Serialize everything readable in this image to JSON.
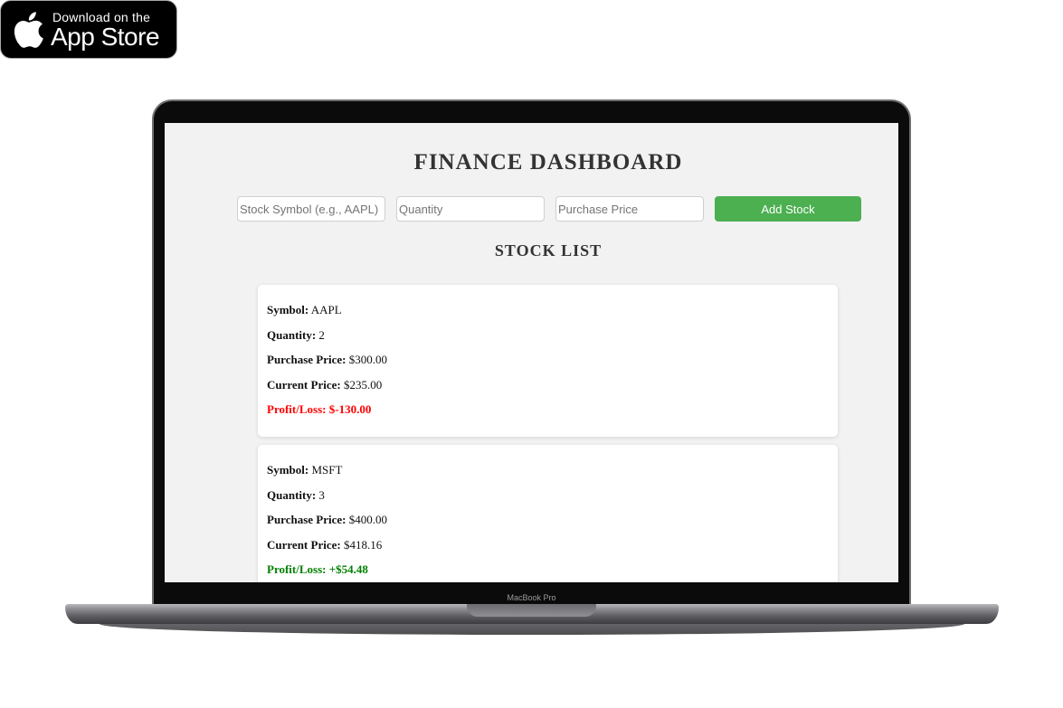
{
  "badge": {
    "line1": "Download on the",
    "line2": "App Store",
    "icon": "apple-icon"
  },
  "laptop": {
    "label": "MacBook Pro"
  },
  "dashboard": {
    "title": "FINANCE DASHBOARD",
    "form": {
      "symbol_placeholder": "Stock Symbol (e.g., AAPL)",
      "quantity_placeholder": "Quantity",
      "price_placeholder": "Purchase Price",
      "add_label": "Add Stock",
      "add_color": "#4caf50"
    },
    "list_title": "STOCK LIST",
    "labels": {
      "symbol": "Symbol:",
      "quantity": "Quantity:",
      "purchase": "Purchase Price:",
      "current": "Current Price:",
      "pl": "Profit/Loss:"
    },
    "stocks": [
      {
        "symbol": "AAPL",
        "quantity": "2",
        "purchase_price": "$300.00",
        "current_price": "$235.00",
        "profit_loss": "$-130.00",
        "pl_color": "#ff0000"
      },
      {
        "symbol": "MSFT",
        "quantity": "3",
        "purchase_price": "$400.00",
        "current_price": "$418.16",
        "profit_loss": "+$54.48",
        "pl_color": "#008000"
      }
    ]
  }
}
